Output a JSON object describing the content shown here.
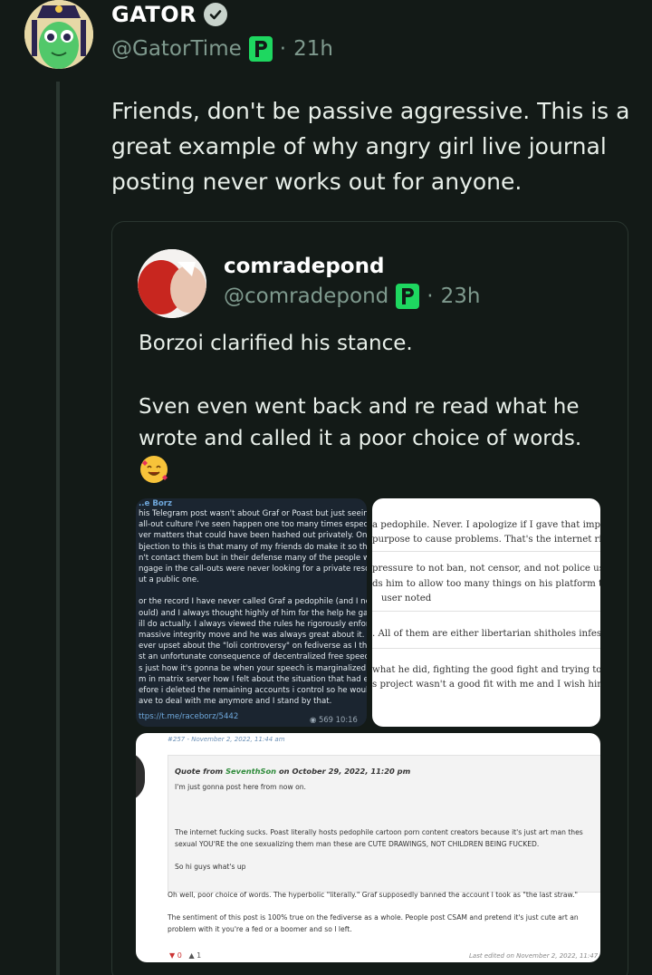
{
  "post": {
    "display_name": "GATOR",
    "handle": "@GatorTime",
    "separator": "·",
    "time": "21h",
    "text": "Friends, don't be passive aggressive. This is a great example of why angry girl live journal posting never works out for anyone."
  },
  "quoted": {
    "display_name": "comradepond",
    "handle": "@comradepond",
    "separator": "·",
    "time": "23h",
    "paragraph_1": "Borzoi clarified his stance.",
    "paragraph_2": "Sven even went back and re read what he wrote and called it a poor choice of words.",
    "emoji": "smiling-face-with-hearts",
    "telegram": {
      "title": "..e Borz",
      "lines": [
        "his Telegram post wasn't about Graf or Poast but just seeing the",
        "all-out culture I've seen happen one too many times especially",
        "ver matters that could have been hashed out privately. One",
        "bjection to this is that many of my friends do make it so that you",
        "n't contact them but in their defense many of the people who",
        "ngage in the call-outs were never looking for a private resolution",
        "ut a public one."
      ],
      "lines_2": [
        "or the record I have never called Graf a pedophile (and I never",
        "ould) and I always thought highly of him for the help he gave me",
        "ill do actually. I always viewed the rules he rigorously enforced as",
        "massive integrity move and he was always great about it. I was",
        "ever upset about the \"loli controversy\" on fediverse as I think it's",
        "st an unfortunate consequence of decentralized free speech tech",
        "s just how it's gonna be when your speech is marginalized. I told",
        "m in matrix server how I felt about the situation that had erupte",
        "efore i deleted the remaining accounts i control so he wouldn't",
        "ave to deal with me anymore and I stand by that."
      ],
      "url": "ttps://t.me/raceborz/5442",
      "views": "569",
      "time": "10:16"
    },
    "white_shot": {
      "lines": [
        "a pedophile. Never. I apologize if I gave that impre",
        "purpose to cause problems. That's the internet righ",
        "pressure to not ban, not censor, and not police use",
        "ds him to allow too many things on his platform th",
        "user noted",
        ". All of them are either libertarian shitholes infeste",
        "what he did, fighting the good fight and trying to g",
        "s project wasn't a good fit with me and I wish him"
      ]
    },
    "forum": {
      "post_id": "#257 - November 2, 2022, 11:44 am",
      "quote_prefix": "Quote from ",
      "quote_author": "SeventhSon",
      "quote_date": " on October 29, 2022, 11:20 pm",
      "quote_line_1": "I'm just gonna post here from now on.",
      "quote_line_2": "The internet fucking sucks. Poast literally hosts pedophile cartoon porn content creators because it's just art man thes",
      "quote_line_3": "sexual YOU'RE the one sexualizing them man these are CUTE DRAWINGS, NOT CHILDREN BEING FUCKED.",
      "quote_line_4": "So hi guys what's up",
      "reply_line_1": "Oh well, poor choice of words. The hyperbolic \"literally.\" Graf supposedly banned the account I took as \"the last straw.\"",
      "reply_line_2": "The sentiment of this post is 100% true on the fediverse as a whole. People post CSAM and pretend it's just cute art an",
      "reply_line_3": "problem with it you're a fed or a boomer and so I left.",
      "votes_down": "0",
      "votes_up": "1",
      "edited": "Last edited on November 2, 2022, 11:47"
    }
  },
  "colors": {
    "background": "#131a17",
    "muted": "#7f9a8e",
    "badge_green": "#1ed760"
  }
}
